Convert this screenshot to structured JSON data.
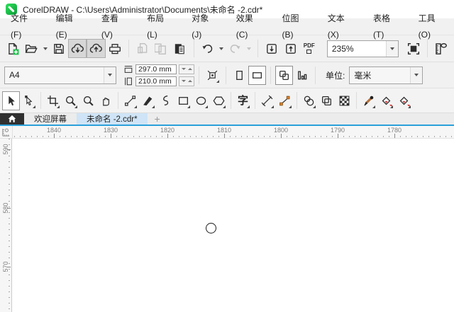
{
  "title_bar": {
    "app_title": "CorelDRAW - C:\\Users\\Administrator\\Documents\\未命名 -2.cdr*"
  },
  "menu_bar": {
    "items": [
      "文件(F)",
      "编辑(E)",
      "查看(V)",
      "布局(L)",
      "对象(J)",
      "效果(C)",
      "位图(B)",
      "文本(X)",
      "表格(T)",
      "工具(O)"
    ]
  },
  "standard_toolbar": {
    "zoom_level": "235%",
    "pdf_icon_label": "PDF"
  },
  "property_bar": {
    "page_size_value": "A4",
    "page_width_value": "297.0 mm",
    "page_height_value": "210.0 mm",
    "units_label": "单位:",
    "units_value": "毫米"
  },
  "toolbox": {
    "text_tool_glyph": "字"
  },
  "document_tabs": {
    "welcome_tab_label": "欢迎屏幕",
    "document_tab_label": "未命名 -2.cdr*",
    "new_tab_glyph": "+"
  },
  "rulers": {
    "horizontal_labels": [
      "1840",
      "1830",
      "1820",
      "1810",
      "1800",
      "1790",
      "1780"
    ],
    "vertical_labels": [
      "590",
      "580",
      "570"
    ]
  },
  "canvas": {
    "objects": [
      {
        "type": "ellipse",
        "description": "small unfilled circle outline near page center"
      }
    ]
  }
}
